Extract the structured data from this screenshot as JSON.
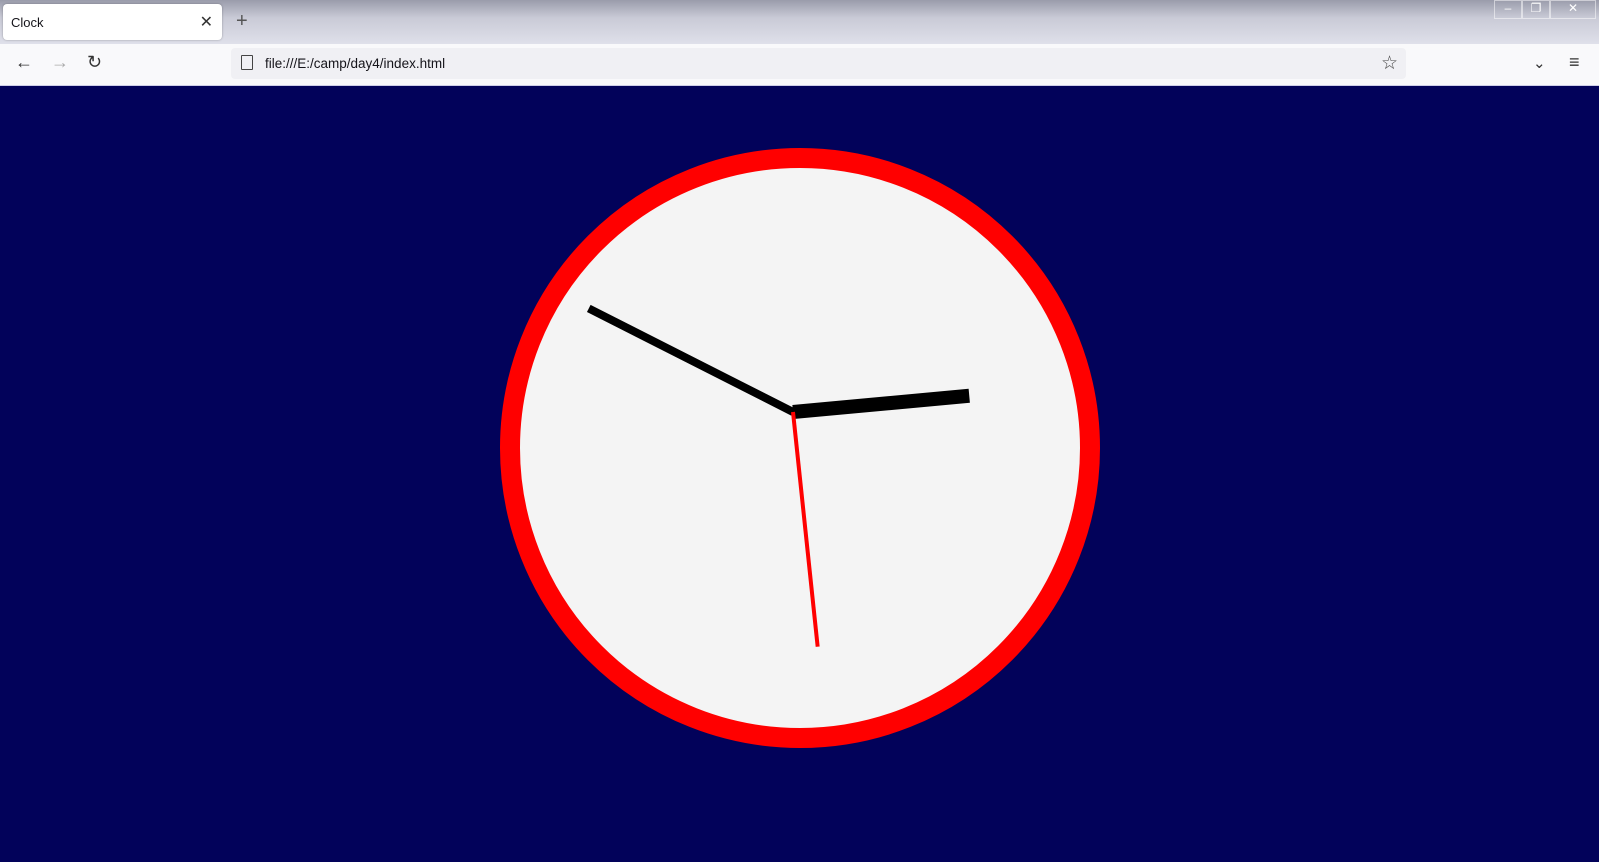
{
  "browser": {
    "tab_title": "Clock",
    "tab_close": "✕",
    "new_tab": "+",
    "url": "file:///E:/camp/day4/index.html",
    "window_controls": {
      "minimize": "–",
      "restore": "❐",
      "close": "✕"
    },
    "nav": {
      "back": "←",
      "forward": "→",
      "reload": "↻"
    },
    "bookmark_star": "☆",
    "pocket": "⌄",
    "menu": "≡"
  },
  "page": {
    "background_color": "#02025a",
    "clock": {
      "face_color": "#f4f4f4",
      "border_color": "#ff0000",
      "hour_hand_color": "#000000",
      "minute_hand_color": "#000000",
      "second_hand_color": "#ff0000",
      "time": {
        "hours": 2,
        "minutes": 49,
        "seconds": 29
      }
    }
  }
}
